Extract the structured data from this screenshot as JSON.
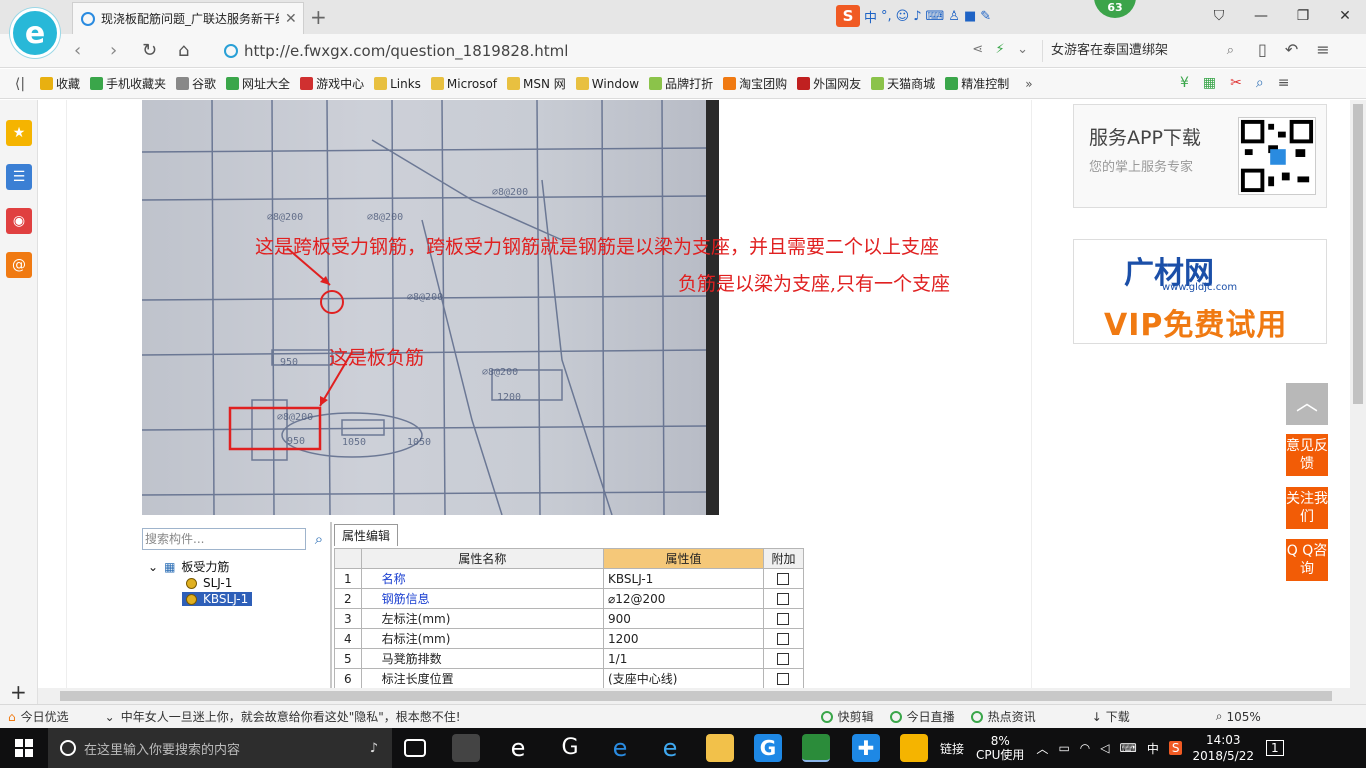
{
  "browser": {
    "tab_title": "现浇板配筋问题_广联达服务新干线",
    "url": "http://e.fwxgx.com/question_1819828.html",
    "search_text": "女游客在泰国遭绑架",
    "sogou_zh": "中",
    "sogou_punct": "°,",
    "badge_count": "63"
  },
  "favorites": [
    {
      "label": "收藏",
      "color": "#e8b010"
    },
    {
      "label": "手机收藏夹",
      "color": "#3aa64a"
    },
    {
      "label": "谷歌",
      "color": "#888888"
    },
    {
      "label": "网址大全",
      "color": "#3aa64a"
    },
    {
      "label": "游戏中心",
      "color": "#d03030"
    },
    {
      "label": "Links",
      "color": "#e8c040"
    },
    {
      "label": "Microsof",
      "color": "#e8c040"
    },
    {
      "label": "MSN 网",
      "color": "#e8c040"
    },
    {
      "label": "Window",
      "color": "#e8c040"
    },
    {
      "label": "品牌打折",
      "color": "#8bc34a"
    },
    {
      "label": "淘宝团购",
      "color": "#f07a12"
    },
    {
      "label": "外国网友",
      "color": "#c02020"
    },
    {
      "label": "天猫商城",
      "color": "#8bc34a"
    },
    {
      "label": "精准控制",
      "color": "#3aa64a"
    }
  ],
  "annotations": {
    "span_bar": "这是跨板受力钢筋，跨板受力钢筋就是钢筋是以梁为支座，并且需要二个以上支座",
    "neg_bar": "负筋是以梁为支座,只有一个支座",
    "slab_neg": "这是板负筋"
  },
  "gld": {
    "search_placeholder": "搜索构件...",
    "tree_root": "板受力筋",
    "tree_items": [
      "SLJ-1",
      "KBSLJ-1"
    ],
    "props_tab": "属性编辑",
    "col_name": "属性名称",
    "col_value": "属性值",
    "col_extra": "附加",
    "rows": [
      {
        "n": "1",
        "name": "名称",
        "value": "KBSLJ-1",
        "blue": true
      },
      {
        "n": "2",
        "name": "钢筋信息",
        "value": "⌀12@200",
        "blue": true
      },
      {
        "n": "3",
        "name": "左标注(mm)",
        "value": "900",
        "blue": false
      },
      {
        "n": "4",
        "name": "右标注(mm)",
        "value": "1200",
        "blue": false
      },
      {
        "n": "5",
        "name": "马凳筋排数",
        "value": "1/1",
        "blue": false
      },
      {
        "n": "6",
        "name": "标注长度位置",
        "value": "(支座中心线)",
        "blue": false
      }
    ]
  },
  "sidebar": {
    "app_title": "服务APP下载",
    "app_sub": "您的掌上服务专家",
    "gcw_logo": "广材网",
    "gcw_url": "www.gldjc.com",
    "gcw_vip": "VIP免费试用",
    "btn_feedback": "意见反馈",
    "btn_follow": "关注我们",
    "btn_qq": "Q Q咨询"
  },
  "statusbar": {
    "today": "今日优选",
    "news": "中年女人一旦迷上你，就会故意给你看这处\"隐私\"，根本憋不住!",
    "quick_cut": "快剪辑",
    "live": "今日直播",
    "hot": "热点资讯",
    "download": "下载",
    "zoom": "105%"
  },
  "taskbar": {
    "search_placeholder": "在这里输入你要搜索的内容",
    "links": "链接",
    "cpu_pct": "8%",
    "cpu_label": "CPU使用",
    "ime": "中",
    "time": "14:03",
    "date": "2018/5/22",
    "notif": "1"
  }
}
